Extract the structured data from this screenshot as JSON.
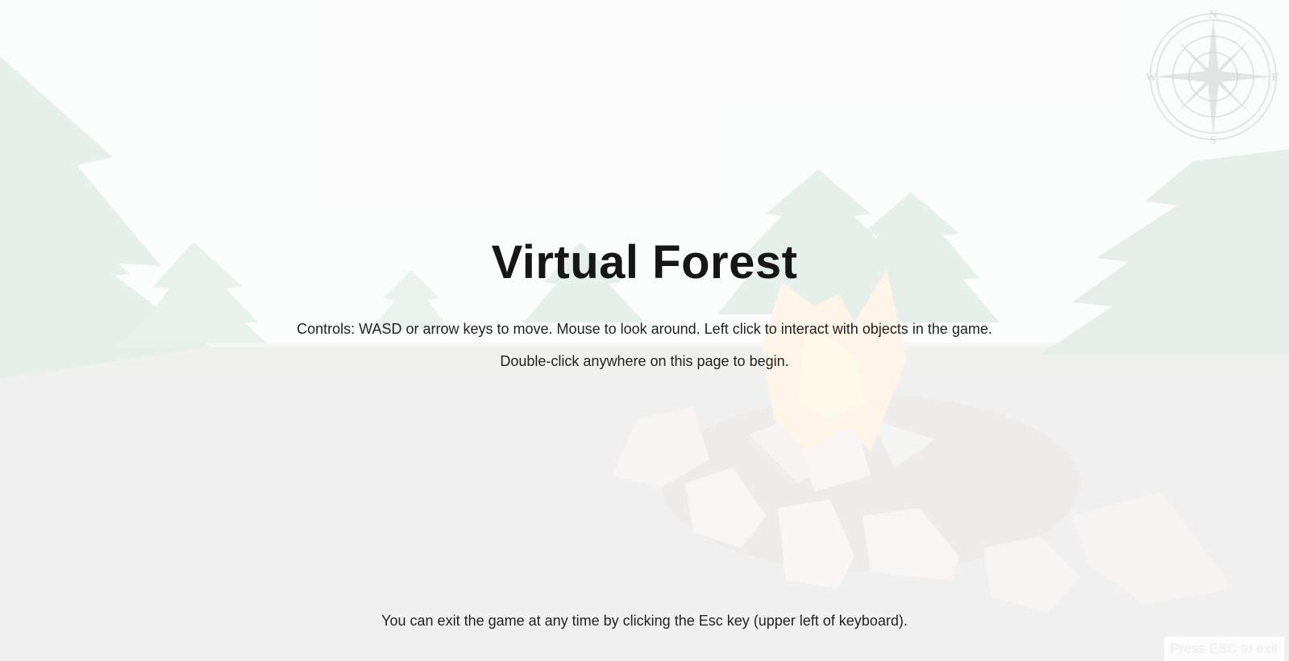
{
  "game": {
    "title": "Virtual Forest",
    "controls_text": "Controls: WASD or arrow keys to move. Mouse to look around. Left click to interact with objects in the game.",
    "begin_text": "Double-click anywhere on this page to begin.",
    "exit_text": "You can exit the game at any time by clicking the Esc key (upper left of keyboard).",
    "esc_hint": "Press ESC to exit"
  },
  "compass": {
    "north": "N",
    "east": "E",
    "south": "S",
    "west": "W",
    "icon": "compass-rose-icon"
  },
  "colors": {
    "tree": "#2f6b3f",
    "ground": "#5a5f55",
    "fire": "#f0a020",
    "rock": "#b8b3ad"
  }
}
